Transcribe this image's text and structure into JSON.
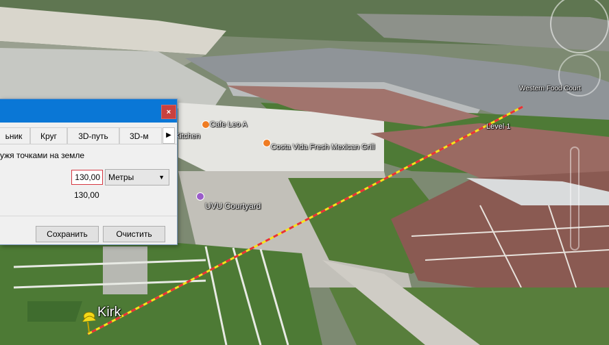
{
  "map": {
    "labels": {
      "building_a": "Cafe Leo A",
      "kitchen": "Kitchen",
      "restaurant": "Costa Vida Fresh Mexican Grill",
      "courtyard": "UVU Courtyard",
      "level": "Level 1",
      "top_right": "Western Food Court",
      "placemark": "Kirk"
    },
    "ruler_line_colors": {
      "primary": "#f5e41c",
      "dash": "#e8303a"
    }
  },
  "dialog": {
    "close_glyph": "×",
    "tabs": [
      "ьник",
      "Круг",
      "3D-путь",
      "3D-м"
    ],
    "tab_scroll_glyph": "▶",
    "description": "ужя точками на земле",
    "length_value": "130,00",
    "unit_selected": "Метры",
    "unit_arrow_glyph": "▼",
    "length_echo": "130,00",
    "save_label": "Сохранить",
    "clear_label": "Очистить"
  }
}
